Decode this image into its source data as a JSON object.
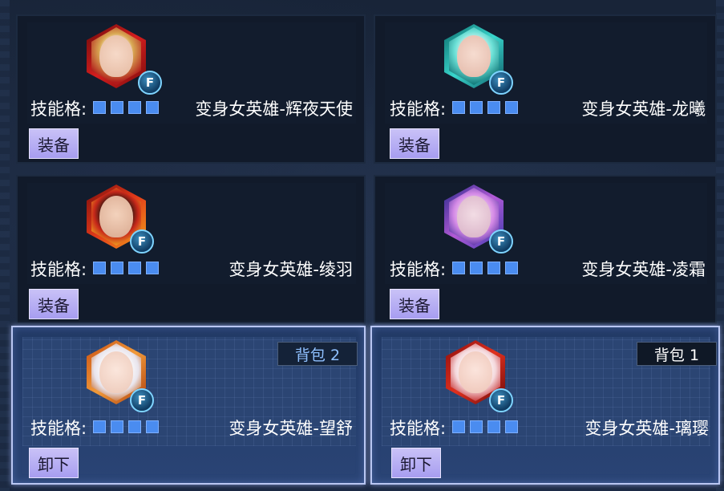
{
  "skill_label": "技能格:",
  "cards": [
    {
      "hero_name": "变身女英雄-辉夜天使",
      "button": "装备",
      "badge": "F",
      "state": "unequipped",
      "slots": 4
    },
    {
      "hero_name": "变身女英雄-龙曦",
      "button": "装备",
      "badge": "F",
      "state": "unequipped",
      "slots": 4
    },
    {
      "hero_name": "变身女英雄-绫羽",
      "button": "装备",
      "badge": "F",
      "state": "unequipped",
      "slots": 4
    },
    {
      "hero_name": "变身女英雄-凌霜",
      "button": "装备",
      "badge": "F",
      "state": "unequipped",
      "slots": 4
    },
    {
      "hero_name": "变身女英雄-望舒",
      "button": "卸下",
      "badge": "F",
      "state": "equipped",
      "bag": "背包 2",
      "slots": 4
    },
    {
      "hero_name": "变身女英雄-璃璎",
      "button": "卸下",
      "badge": "F",
      "state": "equipped",
      "bag": "背包 1",
      "slots": 4
    }
  ],
  "colors": {
    "slot": "#4a8cf0",
    "button_bg": "#b3aaf2",
    "equipped_border": "#b9c6f2",
    "badge": "#1d5b8c"
  }
}
